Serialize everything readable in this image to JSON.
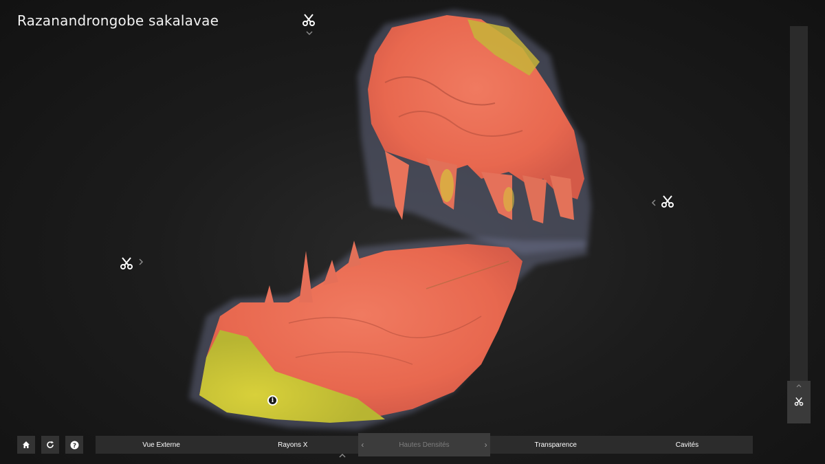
{
  "viewer": {
    "title": "Razanandrongobe sakalavae"
  },
  "cut_controls": {
    "top": {
      "icon": "scissors-icon",
      "chevron": "chevron-down-icon"
    },
    "left": {
      "icon": "scissors-icon",
      "chevron": "chevron-right-icon"
    },
    "right": {
      "icon": "scissors-icon",
      "chevron": "chevron-left-icon"
    },
    "side_panel": {
      "icon": "scissors-icon",
      "chevron": "chevron-up-icon"
    }
  },
  "annotation": {
    "icon": "info-icon",
    "glyph": "i"
  },
  "toolbar": {
    "home": {
      "icon": "home-icon"
    },
    "reset": {
      "icon": "refresh-icon"
    },
    "help": {
      "icon": "help-icon"
    },
    "modes": [
      {
        "label": "Vue Externe",
        "active": false
      },
      {
        "label": "Rayons X",
        "active": false
      },
      {
        "label": "Hautes Densités",
        "active": true
      },
      {
        "label": "Transparence",
        "active": false
      },
      {
        "label": "Cavités",
        "active": false
      }
    ],
    "colors": {
      "bar": "#2c2c2c",
      "active": "#3c3c3c",
      "active_text": "#7f7f7f"
    }
  },
  "model_colors": {
    "halo": "#6f7592",
    "bone": "#e8705a",
    "dense": "#c9c83a"
  }
}
